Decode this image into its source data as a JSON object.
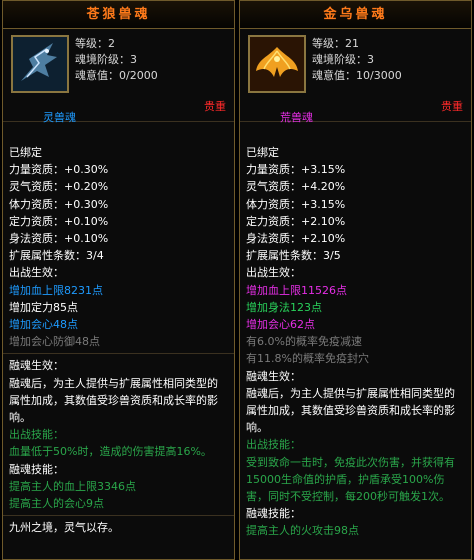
{
  "left": {
    "title": "苍狼兽魂",
    "stats": [
      "等级：2",
      "魂境阶级：3",
      "魂意值：0/2000"
    ],
    "type": "灵兽魂",
    "rarity": "贵重",
    "bound": "已绑定",
    "attrs": [
      "力量资质：+0.30%",
      "灵气资质：+0.20%",
      "体力资质：+0.30%",
      "定力资质：+0.10%",
      "身法资质：+0.10%"
    ],
    "expand": "扩展属性条数：3/4",
    "battle_title": "出战生效：",
    "effects": [
      "增加血上限8231点",
      "增加定力85点",
      "增加会心48点",
      "增加会心防御48点"
    ],
    "fusion_title": "融魂生效：",
    "fusion_desc": "融魂后，为主人提供与扩展属性相同类型的属性加成，其数值受珍兽资质和成长率的影响。",
    "skill_title": "出战技能：",
    "skill1": "血量低于50%时，造成的伤害提高16%。",
    "fusion_skill_title": "融魂技能：",
    "fusion_skills": [
      "提高主人的血上限3346点",
      "提高主人的会心9点"
    ],
    "footer": "九州之境，灵气以存。"
  },
  "right": {
    "title": "金乌兽魂",
    "stats": [
      "等级：21",
      "魂境阶级：3",
      "魂意值：10/3000"
    ],
    "type": "荒兽魂",
    "rarity": "贵重",
    "bound": "已绑定",
    "attrs": [
      "力量资质：+3.15%",
      "灵气资质：+4.20%",
      "体力资质：+3.15%",
      "定力资质：+2.10%",
      "身法资质：+2.10%"
    ],
    "expand": "扩展属性条数：3/5",
    "battle_title": "出战生效：",
    "effects": [
      "增加血上限11526点",
      "增加身法123点",
      "增加会心62点",
      "有6.0%的概率免疫减速",
      "有11.8%的概率免疫封穴"
    ],
    "fusion_title": "融魂生效：",
    "fusion_desc": "融魂后，为主人提供与扩展属性相同类型的属性加成，其数值受珍兽资质和成长率的影响。",
    "skill_title": "出战技能：",
    "skill1": "受到致命一击时，免疫此次伤害，并获得有15000生命值的护盾，护盾承受100%伤害，同时不受控制，每200秒可触发1次。",
    "fusion_skill_title": "融魂技能：",
    "fusion_skills": [
      "提高主人的火攻击98点"
    ]
  },
  "colors": {
    "title": "#ff7a1a",
    "rarity": "#ff2a2a",
    "green": "#29d05a",
    "blue": "#1e9bff",
    "purple": "#e62ee6"
  },
  "icons": {
    "left": "wolf-spirit-icon",
    "right": "golden-crow-icon"
  }
}
